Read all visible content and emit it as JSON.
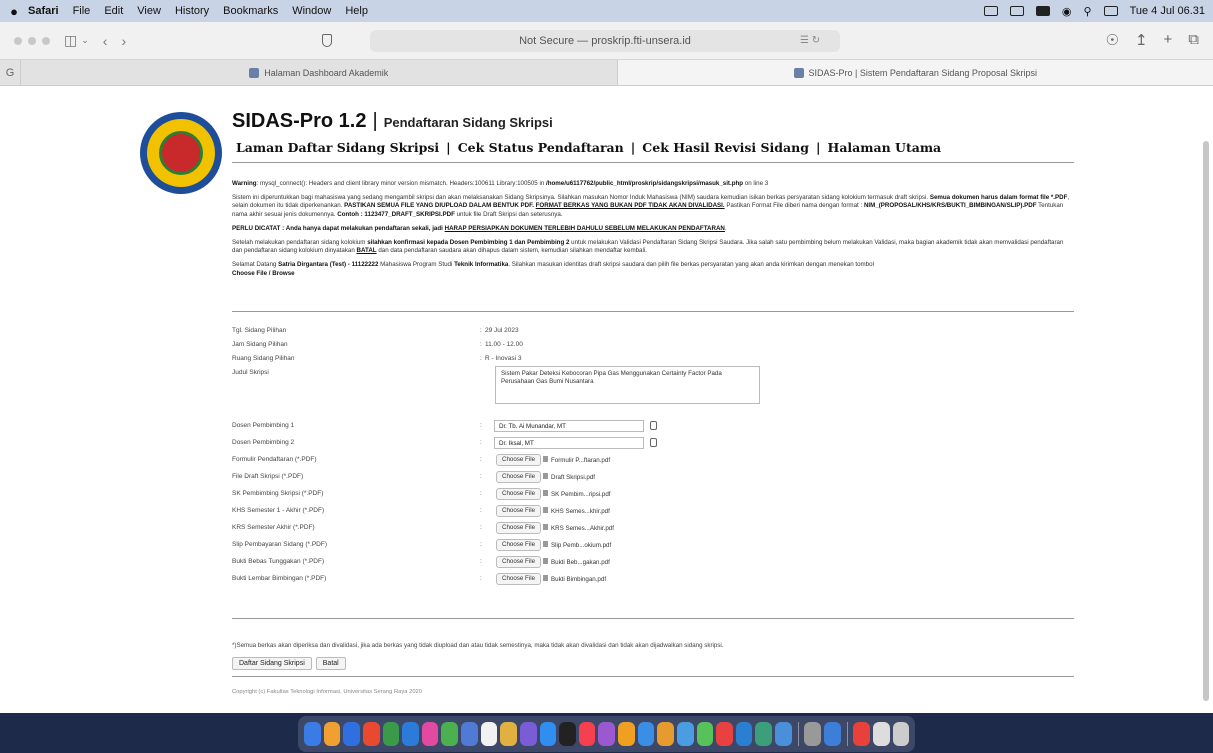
{
  "menubar": {
    "app": "Safari",
    "items": [
      "File",
      "Edit",
      "View",
      "History",
      "Bookmarks",
      "Window",
      "Help"
    ],
    "clock": "Tue 4 Jul 06.31"
  },
  "toolbar": {
    "address": "Not Secure — proskrip.fti-unsera.id"
  },
  "tabs": [
    {
      "label": "Halaman Dashboard Akademik"
    },
    {
      "label": "SIDAS-Pro | Sistem Pendaftaran Sidang Proposal Skripsi"
    }
  ],
  "header": {
    "app_name": "SIDAS-Pro 1.2",
    "separator": "|",
    "subtitle": "Pendaftaran Sidang Skripsi",
    "nav": [
      "Laman Daftar Sidang Skripsi",
      "Cek Status Pendaftaran",
      "Cek Hasil Revisi Sidang",
      "Halaman Utama"
    ]
  },
  "warning": {
    "label": "Warning",
    "text": ": mysql_connect(): Headers and client library minor version mismatch. Headers:100611 Library:100505 in",
    "path": "/home/u6117762/public_html/proskrip/sidangskripsi/masuk_sit.php",
    "line": "on line 3"
  },
  "info": {
    "p1_a": "Sistem ini diperuntukkan bagi mahasiswa yang sedang mengambil skripsi dan akan melaksanakan Sidang Skripsinya. Silahkan masukan Nomor Induk Mahasiswa (NIM) saudara kemudian isikan berkas persyaratan sidang kolokium termasuk draft skripsi.",
    "p1_b": "Semua dokumen harus dalam format file *.PDF",
    "p1_c": ", selain dokumen itu tidak diperkenankan.",
    "p1_d": "PASTIKAN SEMUA FILE YANG DIUPLOAD DALAM BENTUK PDF.",
    "p1_e": "FORMAT BERKAS YANG BUKAN PDF TIDAK AKAN DIVALIDASI.",
    "p1_f": "Pastikan Format File diberi nama dengan format :",
    "p1_g": "NIM_(PROPOSAL/KHS/KRS/BUKTI_BIMBINGAN/SLIP).PDF",
    "p1_h": "Tentukan nama akhir sesuai jenis dokumennya.",
    "p1_i": "Contoh : 1123477_DRAFT_SKRIPSI.PDF",
    "p1_j": "untuk file Draft Skripsi dan seterusnya.",
    "p2_a": "PERLU DICATAT : Anda hanya dapat melakukan pendaftaran sekali, jadi",
    "p2_b": "HARAP PERSIAPKAN DOKUMEN TERLEBIH DAHULU SEBELUM MELAKUKAN PENDAFTARAN",
    "p3_a": "Setelah melakukan pendaftaran sidang kolokium",
    "p3_b": "silahkan konfirmasi kepada Dosen Pembimbing 1 dan Pembimbing 2",
    "p3_c": "untuk melakukan Validasi Pendaftaran Sidang Skripsi Saudara. Jika salah satu pembimbing belum melakukan Validasi, maka bagian akademik tidak akan memvalidasi pendaftaran dan pendaftaran sidang kolokium dinyatakan",
    "p3_d": "BATAL",
    "p3_e": "dan data pendaftaran saudara akan dihapus dalam sistem, kemudian silahkan mendaftar kembali.",
    "p4_a": "Selamat Datang",
    "p4_b": "Satria Dirgantara (Test) - 11122222",
    "p4_c": "Mahasiswa Program Studi",
    "p4_d": "Teknik Informatika",
    "p4_e": ". Silahkan masukan identitas draft skripsi saudara dan pilih file berkas persyaratan yang akan anda kirimkan dengan menekan tombol",
    "p4_f": "Choose File / Browse"
  },
  "form": {
    "tgl_label": "Tgl. Sidang Pilihan",
    "tgl_value": "29 Jul 2023",
    "jam_label": "Jam Sidang Pilihan",
    "jam_value": "11.00 - 12.00",
    "ruang_label": "Ruang Sidang Pilihan",
    "ruang_value": "R - Inovasi 3",
    "judul_label": "Judul Skripsi",
    "judul_value": "Sistem Pakar Deteksi Kebocoran Pipa Gas Menggunakan Certainty Factor Pada Perusahaan Gas Bumi Nusantara",
    "dosen1_label": "Dosen Pembimbing 1",
    "dosen1_value": "Dr. Tb. Ai Munandar, MT",
    "dosen2_label": "Dosen Pembimbing 2",
    "dosen2_value": "Dr. Iksal, MT",
    "choose_label": "Choose File",
    "files": [
      {
        "label": "Formulir Pendaftaran (*.PDF)",
        "file": "Formulir P...ftaran.pdf"
      },
      {
        "label": "File Draft Skripsi (*.PDF)",
        "file": "Draft Skripsi.pdf"
      },
      {
        "label": "SK Pembimbing Skripsi (*.PDF)",
        "file": "SK Pembim...ripsi.pdf"
      },
      {
        "label": "KHS Semester 1 - Akhir (*.PDF)",
        "file": "KHS Semes...khir.pdf"
      },
      {
        "label": "KRS Semester Akhir (*.PDF)",
        "file": "KRS Semes...Akhir.pdf"
      },
      {
        "label": "Slip Pembayaran Sidang (*.PDF)",
        "file": "Slip Pemb...okium.pdf"
      },
      {
        "label": "Bukti Bebas Tunggakan (*.PDF)",
        "file": "Bukti Beb...gakan.pdf"
      },
      {
        "label": "Bukti Lembar Bimbingan (*.PDF)",
        "file": "Bukti Bimbingan.pdf"
      }
    ],
    "note": "*)Semua berkas akan diperiksa dan divalidasi, jika ada berkas yang tidak diupload dan atau tidak semestinya, maka tidak akan divalidasi dan tidak akan dijadwalkan sidang skripsi.",
    "submit_label": "Daftar Sidang Skripsi",
    "cancel_label": "Batal"
  },
  "footer": {
    "copyright": "Copyright (c) Fakultas Teknologi Informasi, Universitas Serang Raya 2020"
  },
  "dock": {
    "colors": [
      "#3b7be6",
      "#f0a030",
      "#2f6fe0",
      "#e8492f",
      "#3a9a49",
      "#2d7bd8",
      "#e04aa0",
      "#4caf50",
      "#4f7ad6",
      "#f2f2f2",
      "#e0b040",
      "#7a5cd6",
      "#2f8ef0",
      "#222222",
      "#f5404f",
      "#9b59d0",
      "#f0a020",
      "#3a8ee6",
      "#e69b2f",
      "#4a9de0",
      "#58c25a",
      "#e94040",
      "#2a7fd0",
      "#3a9f7a",
      "#4a8fd9",
      "#999999",
      "#3d7fd8",
      "#e8413b",
      "#dddddd",
      "#cccccc"
    ]
  }
}
